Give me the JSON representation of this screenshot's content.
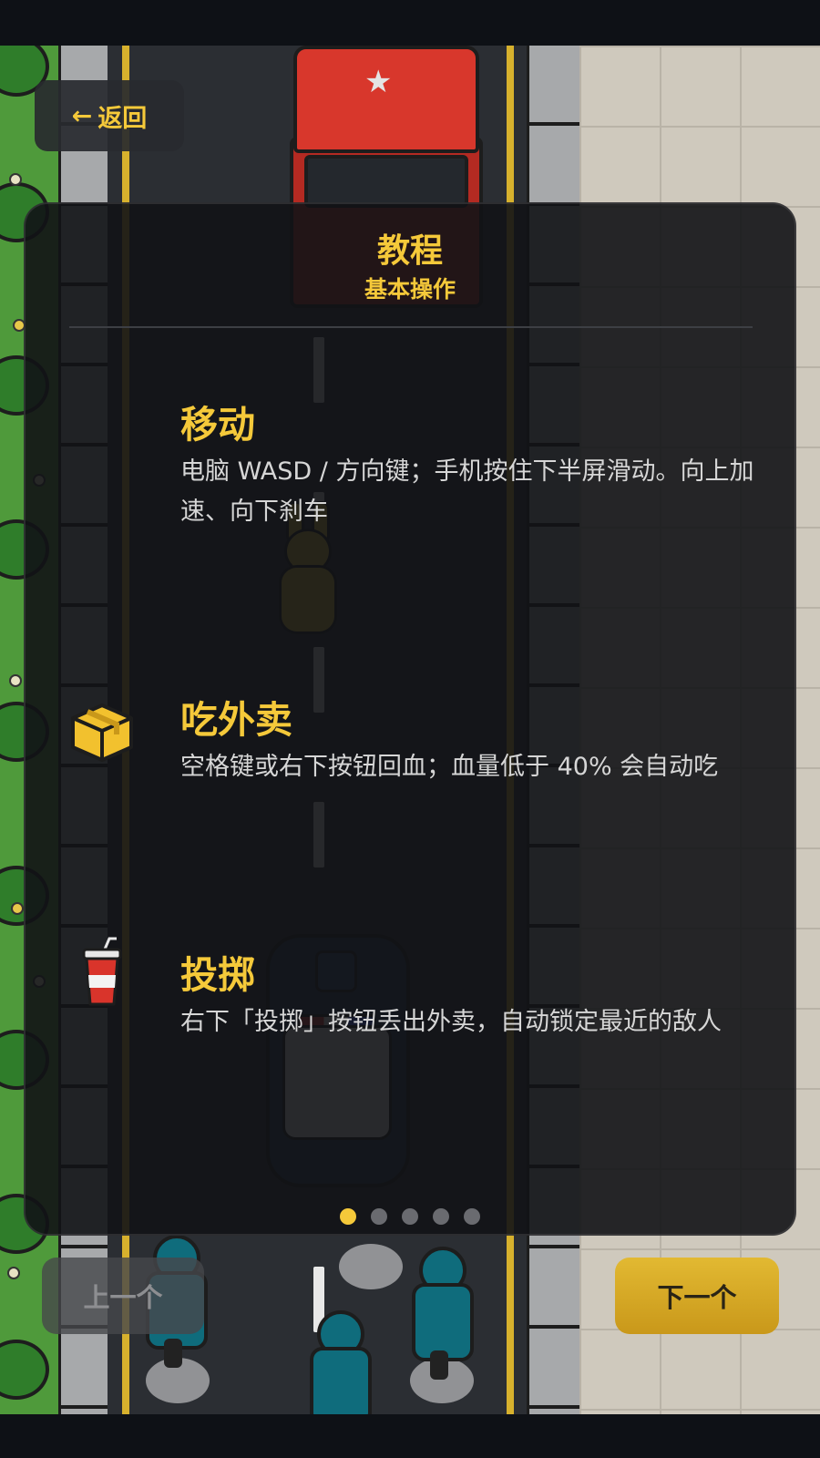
{
  "back_button": {
    "arrow": "←",
    "label": "返回"
  },
  "panel": {
    "title": "教程",
    "subtitle": "基本操作",
    "sections": [
      {
        "title": "移动",
        "description": "电脑 WASD / 方向键；手机按住下半屏滑动。向上加速、向下刹车",
        "icon": "none"
      },
      {
        "title": "吃外卖",
        "description": "空格键或右下按钮回血；血量低于 40% 会自动吃",
        "icon": "food-box-icon"
      },
      {
        "title": "投掷",
        "description": "右下「投掷」按钮丢出外卖，自动锁定最近的敌人",
        "icon": "drink-cup-icon"
      }
    ],
    "page_indicator": {
      "current": 1,
      "total": 5
    }
  },
  "nav": {
    "prev_label": "上一个",
    "next_label": "下一个"
  },
  "colors": {
    "accent": "#f5c93a",
    "panel_bg": "#121316",
    "text": "#d6d6d6"
  }
}
